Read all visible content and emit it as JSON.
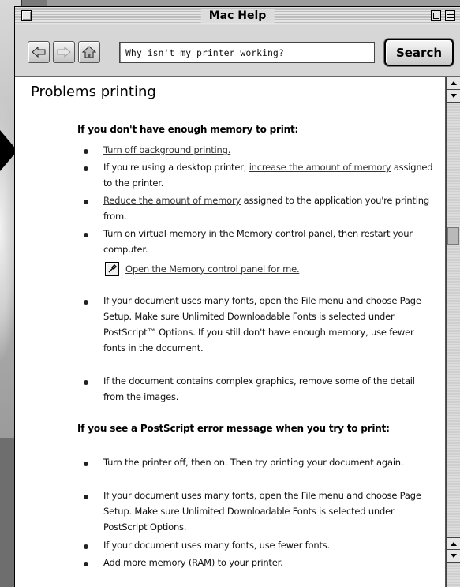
{
  "window": {
    "title": "Mac Help"
  },
  "toolbar": {
    "search_value": "Why isn't my printer working?",
    "search_button": "Search"
  },
  "content": {
    "page_title": "Problems printing",
    "section1": {
      "heading": "If you don't have enough memory to print:",
      "item1_link": "Turn off background printing.",
      "item2_pre": "If you're using a desktop printer, ",
      "item2_link": "increase the amount of memory",
      "item2_post": " assigned to the printer.",
      "item3_link": "Reduce the amount of memory",
      "item3_post": " assigned to the application you're printing from.",
      "item4": "Turn on virtual memory in the Memory control panel, then restart your computer.",
      "memory_link": "Open the Memory control panel for me.",
      "item5": "If your document uses many fonts, open the File menu and choose Page Setup. Make sure Unlimited Downloadable Fonts is selected under PostScript™ Options. If you still don't have enough memory, use fewer fonts in the document.",
      "item6": "If the document contains complex graphics, remove some of the detail from the images."
    },
    "section2": {
      "heading": "If you see a PostScript error message when you try to print:",
      "item1": "Turn the printer off, then on. Then try printing your document again.",
      "item2": "If your document uses many fonts, open the File menu and choose Page Setup. Make sure Unlimited Downloadable Fonts is selected under PostScript Options.",
      "item3": "If your document uses many fonts, use fewer fonts.",
      "item4": "Add more memory (RAM) to your printer."
    }
  },
  "colors": {
    "window_bg": "#dcdcdc",
    "content_bg": "#ffffff",
    "link": "#333333"
  },
  "icons": [
    "back-arrow-icon",
    "forward-arrow-icon",
    "home-icon",
    "close-box-icon",
    "zoom-box-icon",
    "collapse-box-icon",
    "apple-guide-icon"
  ]
}
